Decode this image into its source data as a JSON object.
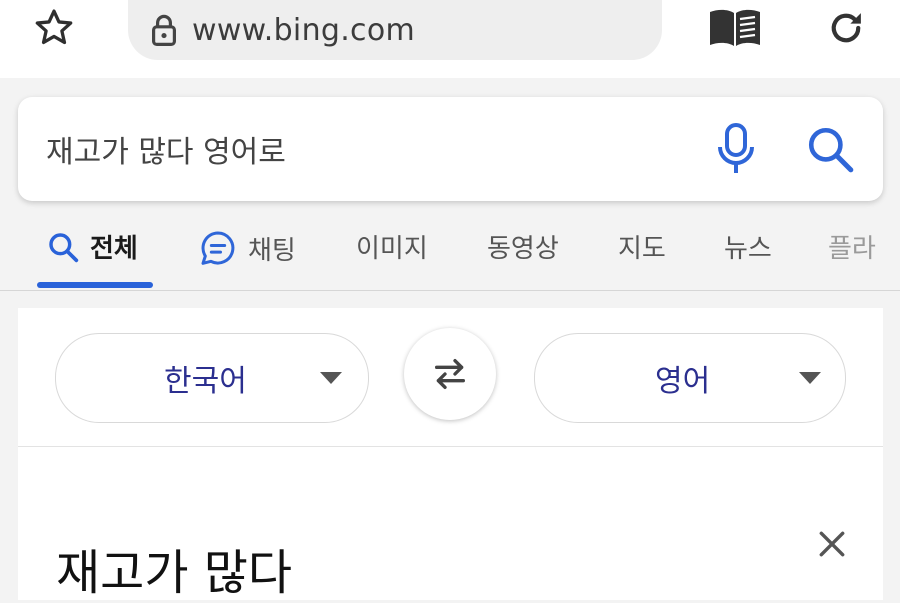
{
  "browser": {
    "url": "www.bing.com",
    "icons": {
      "bookmark": "star-icon",
      "lock": "lock-icon",
      "reader": "reader-mode-icon",
      "reload": "reload-icon"
    }
  },
  "search": {
    "query": "재고가 많다 영어로",
    "icons": {
      "voice": "microphone-icon",
      "submit": "search-icon"
    }
  },
  "tabs": [
    {
      "label": "전체",
      "icon": "search-icon",
      "active": true
    },
    {
      "label": "채팅",
      "icon": "chat-icon"
    },
    {
      "label": "이미지"
    },
    {
      "label": "동영상"
    },
    {
      "label": "지도"
    },
    {
      "label": "뉴스"
    },
    {
      "label": "플라"
    }
  ],
  "translator": {
    "source_lang": "한국어",
    "target_lang": "영어",
    "source_text": "재고가 많다",
    "icons": {
      "swap": "swap-icon",
      "clear": "close-icon",
      "dropdown": "caret-down-icon"
    }
  },
  "colors": {
    "accent": "#2962d9",
    "language_text": "#2b2f8f",
    "icon_blue": "#2f66d8"
  }
}
